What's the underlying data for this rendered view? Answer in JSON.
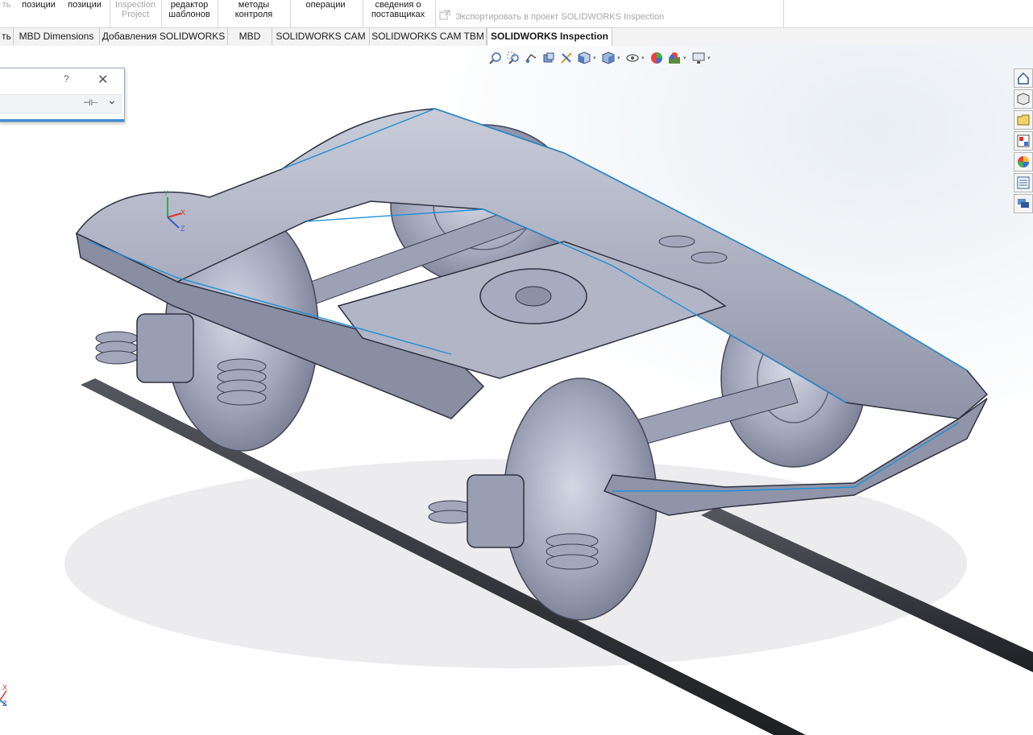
{
  "ribbon": {
    "items": [
      {
        "l1": "ть",
        "l2": "",
        "disabled": true
      },
      {
        "l1": "позиции",
        "l2": "",
        "disabled": false
      },
      {
        "l1": "позиции",
        "l2": "",
        "disabled": false
      },
      {
        "l1": "Inspection",
        "l2": "Project",
        "disabled": true
      },
      {
        "l1": "редактор",
        "l2": "шаблонов",
        "disabled": false
      },
      {
        "l1": "методы",
        "l2": "контроля",
        "disabled": false
      },
      {
        "l1": "операции",
        "l2": "",
        "disabled": false
      },
      {
        "l1": "сведения о",
        "l2": "поставщиках",
        "disabled": false
      }
    ],
    "export_label": "Экспортировать в проект SOLIDWORKS Inspection"
  },
  "tabs": [
    {
      "label": "ть",
      "active": false
    },
    {
      "label": "MBD Dimensions",
      "active": false
    },
    {
      "label": "Добавления SOLIDWORKS",
      "active": false
    },
    {
      "label": "MBD",
      "active": false
    },
    {
      "label": "SOLIDWORKS CAM",
      "active": false
    },
    {
      "label": "SOLIDWORKS CAM TBM",
      "active": false
    },
    {
      "label": "SOLIDWORKS Inspection",
      "active": true
    }
  ],
  "heads_up_toolbar": [
    "zoom-to-fit-icon",
    "zoom-to-area-icon",
    "previous-view-icon",
    "section-view-icon",
    "dynamic-annotation-icon",
    "view-orientation-icon",
    "display-style-icon",
    "hide-show-items-icon",
    "edit-appearance-icon",
    "apply-scene-icon",
    "view-settings-icon"
  ],
  "dialog": {
    "help": "?",
    "close": "✕",
    "pin": "⊣⊢",
    "expand": "⌄"
  },
  "taskpane": [
    "home-icon",
    "design-library-icon",
    "file-explorer-icon",
    "view-palette-icon",
    "appearances-icon",
    "custom-properties-icon",
    "forum-icon"
  ],
  "axis_labels": {
    "x": "X",
    "y": "Y",
    "z": "Z"
  },
  "colors": {
    "model": "#a9adc2",
    "edge": "#1e8fd8",
    "rail": "#3a3b40"
  }
}
